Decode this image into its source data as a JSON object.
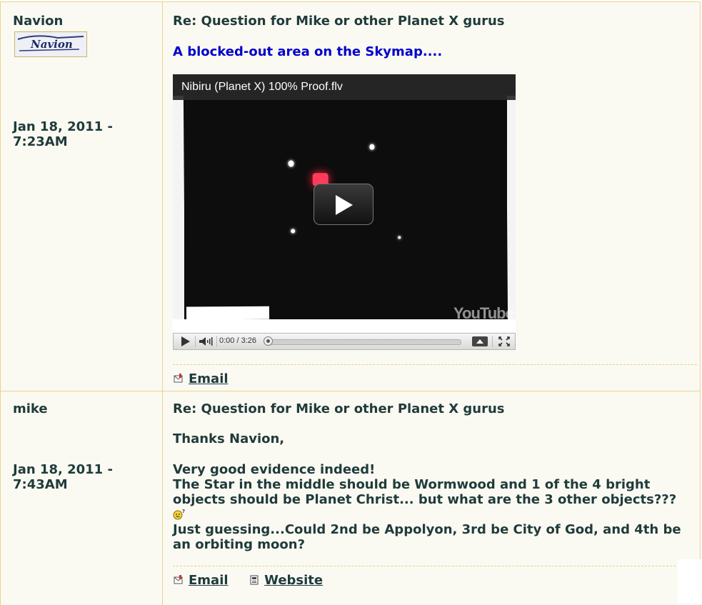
{
  "posts": [
    {
      "author": "Navion",
      "author_logo_text": "Navion",
      "date": "Jan 18, 2011 - 7:23AM",
      "subject": "Re: Question for Mike or other Planet X gurus",
      "link_text": "A blocked-out area on the Skymap....",
      "video": {
        "title": "Nibiru (Planet X) 100% Proof.flv",
        "time": "0:00 / 3:26",
        "progress": 0,
        "watermark": "YouTube",
        "play_icon": "play-icon",
        "volume_icon": "volume-icon",
        "quality_icon": "triangle-up-icon",
        "fullscreen_icon": "fullscreen-icon"
      },
      "footer": {
        "email_label": "Email",
        "email_icon": "email-icon"
      }
    },
    {
      "author": "mike",
      "date": "Jan 18, 2011 - 7:43AM",
      "subject": "Re: Question for Mike or other Planet X gurus",
      "greeting": "Thanks Navion,",
      "line1": "Very good evidence indeed!",
      "line2": "The Star in the middle should be Wormwood and 1 of the 4 bright objects should be Planet Christ... but what are the 3 other objects???",
      "emoticon": "confused-smiley-icon",
      "line3": "Just guessing...Could 2nd be Appolyon, 3rd be City of God, and 4th be an orbiting moon?",
      "footer": {
        "email_label": "Email",
        "email_icon": "email-icon",
        "website_label": "Website",
        "website_icon": "website-icon"
      }
    }
  ]
}
